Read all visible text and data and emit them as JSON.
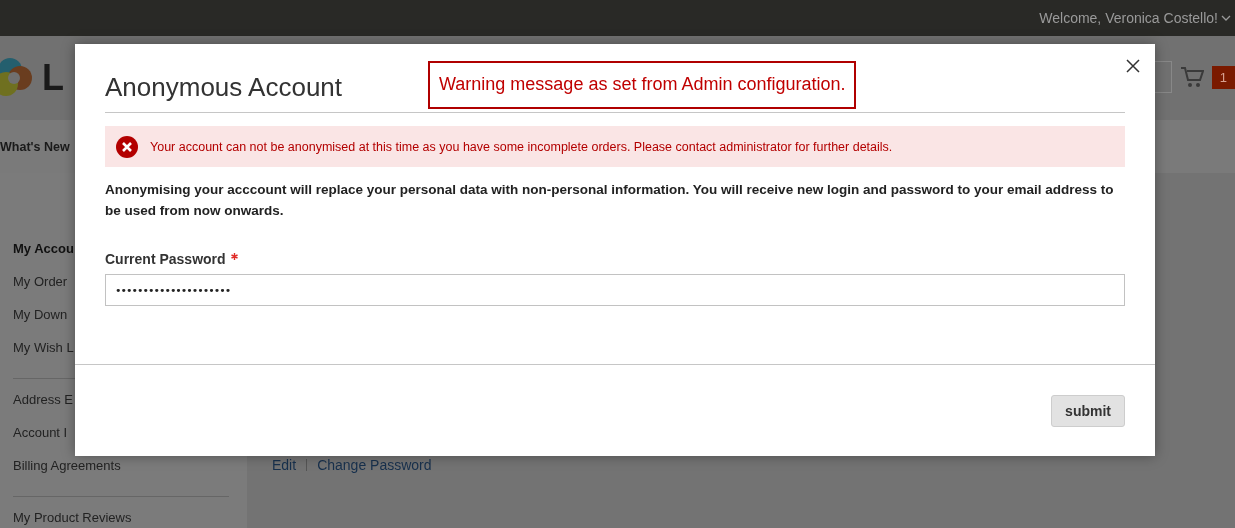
{
  "top_bar": {
    "welcome": "Welcome, Veronica Costello!"
  },
  "header": {
    "logo_text": "L",
    "cart_count": "1"
  },
  "nav": {
    "items": [
      "What's New"
    ]
  },
  "sidebar": {
    "groups": [
      [
        {
          "label": "My Accou",
          "selected": true
        },
        {
          "label": "My Order",
          "selected": false
        },
        {
          "label": "My Down",
          "selected": false
        },
        {
          "label": "My Wish L",
          "selected": false
        }
      ],
      [
        {
          "label": "Address E",
          "selected": false
        },
        {
          "label": "Account I",
          "selected": false
        },
        {
          "label": "Billing Agreements",
          "selected": false
        }
      ],
      [
        {
          "label": "My Product Reviews",
          "selected": false
        }
      ]
    ]
  },
  "content": {
    "links": [
      "Edit",
      "Change Password"
    ]
  },
  "modal": {
    "title": "Anonymous Account",
    "warning": "Warning message as set from Admin configuration.",
    "error": "Your account can not be anonymised at this time as you have some incomplete orders. Please contact administrator for further details.",
    "description": "Anonymising your acccount will replace your personal data with non-personal information. You will receive new login and password to your email address to be used from now onwards.",
    "field": {
      "label": "Current Password",
      "required": true,
      "value": "•••••••••••••••••••••"
    },
    "buttons": [
      "submit"
    ]
  }
}
